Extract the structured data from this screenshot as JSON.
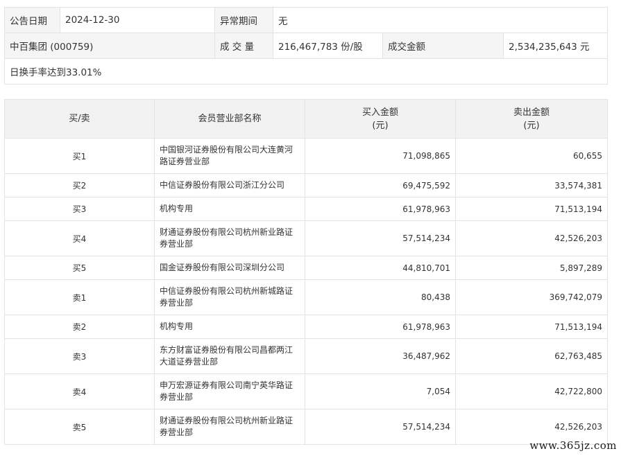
{
  "header": {
    "date_label": "公告日期",
    "date_value": "2024-12-30",
    "period_label": "异常期间",
    "period_value": "无",
    "stock": "中百集团 (000759)",
    "volume_label": "成 交 量",
    "volume_value": "216,467,783 份/股",
    "amount_label": "成交金额",
    "amount_value": "2,534,235,643 元",
    "turnover_text": "日换手率达到33.01%"
  },
  "table": {
    "headers": {
      "side": "买/卖",
      "member": "会员营业部名称",
      "buy": "买入金额\n(元)",
      "sell": "卖出金额\n(元)"
    },
    "rows": [
      {
        "side": "买1",
        "name": "中国银河证券股份有限公司大连黄河路证券营业部",
        "buy": "71,098,865",
        "sell": "60,655"
      },
      {
        "side": "买2",
        "name": "中信证券股份有限公司浙江分公司",
        "buy": "69,475,592",
        "sell": "33,574,381"
      },
      {
        "side": "买3",
        "name": "机构专用",
        "buy": "61,978,963",
        "sell": "71,513,194"
      },
      {
        "side": "买4",
        "name": "财通证券股份有限公司杭州新业路证券营业部",
        "buy": "57,514,234",
        "sell": "42,526,203"
      },
      {
        "side": "买5",
        "name": "国金证券股份有限公司深圳分公司",
        "buy": "44,810,701",
        "sell": "5,897,289"
      },
      {
        "side": "卖1",
        "name": "中信证券股份有限公司杭州新城路证券营业部",
        "buy": "80,438",
        "sell": "369,742,079"
      },
      {
        "side": "卖2",
        "name": "机构专用",
        "buy": "61,978,963",
        "sell": "71,513,194"
      },
      {
        "side": "卖3",
        "name": "东方财富证券股份有限公司昌都两江大道证券营业部",
        "buy": "36,487,962",
        "sell": "62,763,485"
      },
      {
        "side": "卖4",
        "name": "申万宏源证券有限公司南宁英华路证券营业部",
        "buy": "7,054",
        "sell": "42,722,800"
      },
      {
        "side": "卖5",
        "name": "财通证券股份有限公司杭州新业路证券营业部",
        "buy": "57,514,234",
        "sell": "42,526,203"
      }
    ]
  },
  "watermark": "www.365jz.com"
}
